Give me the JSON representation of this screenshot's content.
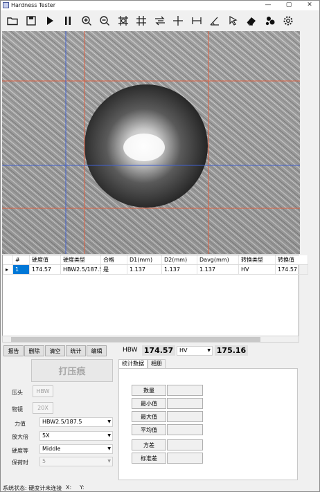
{
  "window": {
    "title": "Hardness Tester",
    "min_glyph": "—",
    "max_glyph": "▢",
    "close_glyph": "✕"
  },
  "toolbar": {
    "icons": [
      "open-folder-icon",
      "save-icon",
      "play-icon",
      "pause-icon",
      "zoom-in-icon",
      "zoom-out-icon",
      "fit-crosshair-icon",
      "grid-icon",
      "swap-arrows-icon",
      "crosshair-plus-icon",
      "measure-horizontal-icon",
      "angle-icon",
      "select-cursor-icon",
      "eraser-icon",
      "particles-icon",
      "gear-icon"
    ]
  },
  "table": {
    "columns": [
      "#",
      "硬度值",
      "硬度类型",
      "合格",
      "D1(mm)",
      "D2(mm)",
      "Davg(mm)",
      "转换类型",
      "转换值"
    ],
    "rows": [
      {
        "marker": "▸",
        "cells": [
          "1",
          "174.57",
          "HBW2.5/187.5",
          "是",
          "1.137",
          "1.137",
          "1.137",
          "HV",
          "174.57"
        ]
      }
    ]
  },
  "actions": {
    "report": "报告",
    "delete": "删除",
    "clear": "清空",
    "stats": "统计",
    "edit": "编辑"
  },
  "readout": {
    "hbw_label": "HBW",
    "hbw_value": "174.57",
    "convert_type": "HV",
    "convert_value": "175.16"
  },
  "controls": {
    "press_button": "打压痕",
    "indenter_label": "压头",
    "indenter_value": "HBW",
    "objective_label": "物镜",
    "objective_value": "20X",
    "force_label": "力值",
    "force_value": "HBW2.5/187.5",
    "magnification_label": "放大倍",
    "magnification_value": "5X",
    "hardness_level_label": "硬度等",
    "hardness_level_value": "Middle",
    "dwell_label": "保荷时",
    "dwell_value": "5"
  },
  "stats_panel": {
    "tabs": [
      "统计数据",
      "相册"
    ],
    "rows": [
      {
        "label": "数量",
        "value": ""
      },
      {
        "label": "最小值",
        "value": ""
      },
      {
        "label": "最大值",
        "value": ""
      },
      {
        "label": "平均值",
        "value": ""
      },
      {
        "label": "方差",
        "value": ""
      },
      {
        "label": "标准差",
        "value": ""
      }
    ]
  },
  "status": {
    "text": "系统状态: 硬度计未连接",
    "x_label": "X:",
    "y_label": "Y:"
  },
  "colors": {
    "selection": "#0078d7",
    "guide_red": "#e06040",
    "guide_blue": "#4060d0"
  }
}
